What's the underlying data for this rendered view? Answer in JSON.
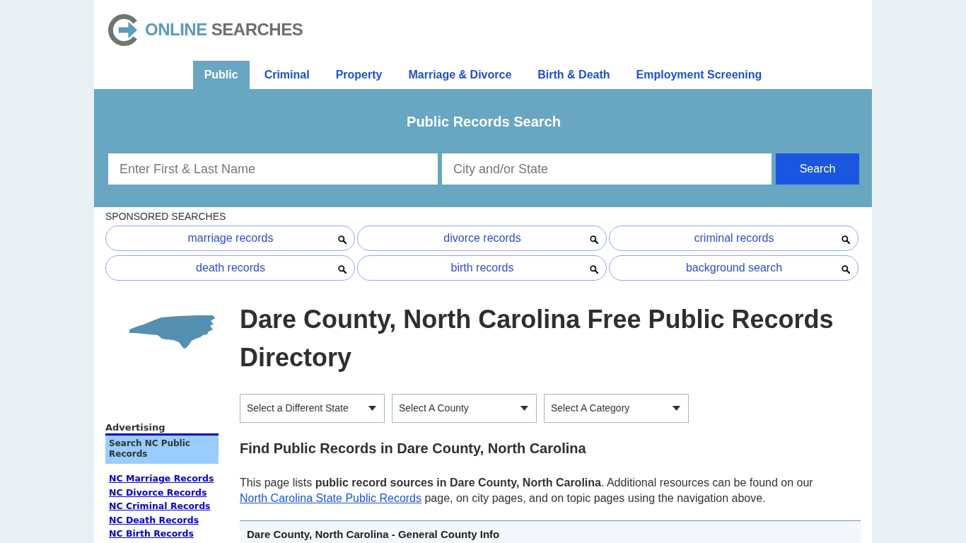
{
  "logo": {
    "first": "ONLINE",
    "second": "SEARCHES"
  },
  "nav": [
    {
      "label": "Public",
      "selected": true
    },
    {
      "label": "Criminal",
      "selected": false
    },
    {
      "label": "Property",
      "selected": false
    },
    {
      "label": "Marriage & Divorce",
      "selected": false
    },
    {
      "label": "Birth & Death",
      "selected": false
    },
    {
      "label": "Employment Screening",
      "selected": false
    }
  ],
  "search": {
    "title": "Public Records Search",
    "name_field": {
      "placeholder": "Enter First & Last Name"
    },
    "location_field": {
      "placeholder": "City and/or State"
    },
    "button": "Search"
  },
  "sponsored": {
    "title": "SPONSORED SEARCHES",
    "items": [
      "marriage records",
      "divorce records",
      "criminal records",
      "death records",
      "birth records",
      "background search"
    ]
  },
  "sidebar": {
    "advertising": {
      "title": "Advertising",
      "box": "Search NC Public Records",
      "links": [
        "NC Marriage Records",
        "NC Divorce Records",
        "NC Criminal Records",
        "NC Death Records",
        "NC Birth Records"
      ]
    }
  },
  "main": {
    "title": "Dare County, North Carolina Free Public Records Directory",
    "selects": [
      "Select a Different State",
      "Select A County",
      "Select A Category"
    ],
    "subtitle": "Find Public Records in Dare County, North Carolina",
    "intro": {
      "before": "This page lists **public record sources in Dare County, North Carolina**. Additional resources can be found on our",
      "link": "North Carolina State Public Records",
      "after": "page, on city pages, and on topic pages using the navigation above."
    },
    "table": {
      "header": "Dare County, North Carolina - General County Info"
    }
  }
}
